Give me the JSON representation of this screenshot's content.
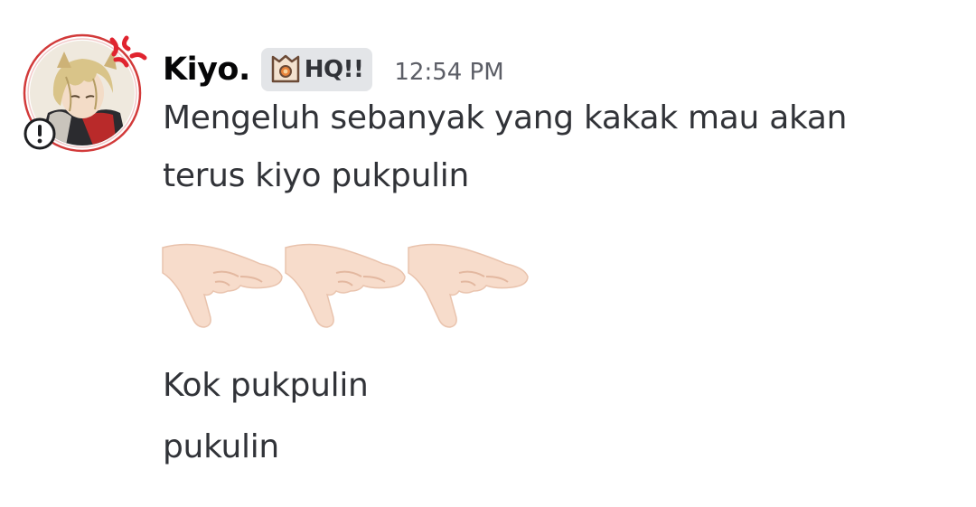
{
  "message": {
    "author": {
      "username": "Kiyo.",
      "tag_label": "HQ!!",
      "avatar_status_icon": "anger-symbol-icon",
      "avatar_alert_icon": "exclamation-alert-icon",
      "tag_icon": "badge-icon"
    },
    "timestamp": "12:54 PM",
    "lines": [
      "Mengeluh sebanyak yang kakak mau akan",
      "terus kiyo pukpulin"
    ],
    "emojis": [
      "palm-down-hand-icon",
      "palm-down-hand-icon",
      "palm-down-hand-icon"
    ],
    "follow_up_lines": [
      "Kok pukpulin",
      "pukulin"
    ]
  },
  "colors": {
    "background": "#ffffff",
    "username": "#060607",
    "text": "#313338",
    "timestamp": "#5c5e66",
    "tag_background": "#e3e5e8",
    "anger_red": "#e0242f"
  }
}
